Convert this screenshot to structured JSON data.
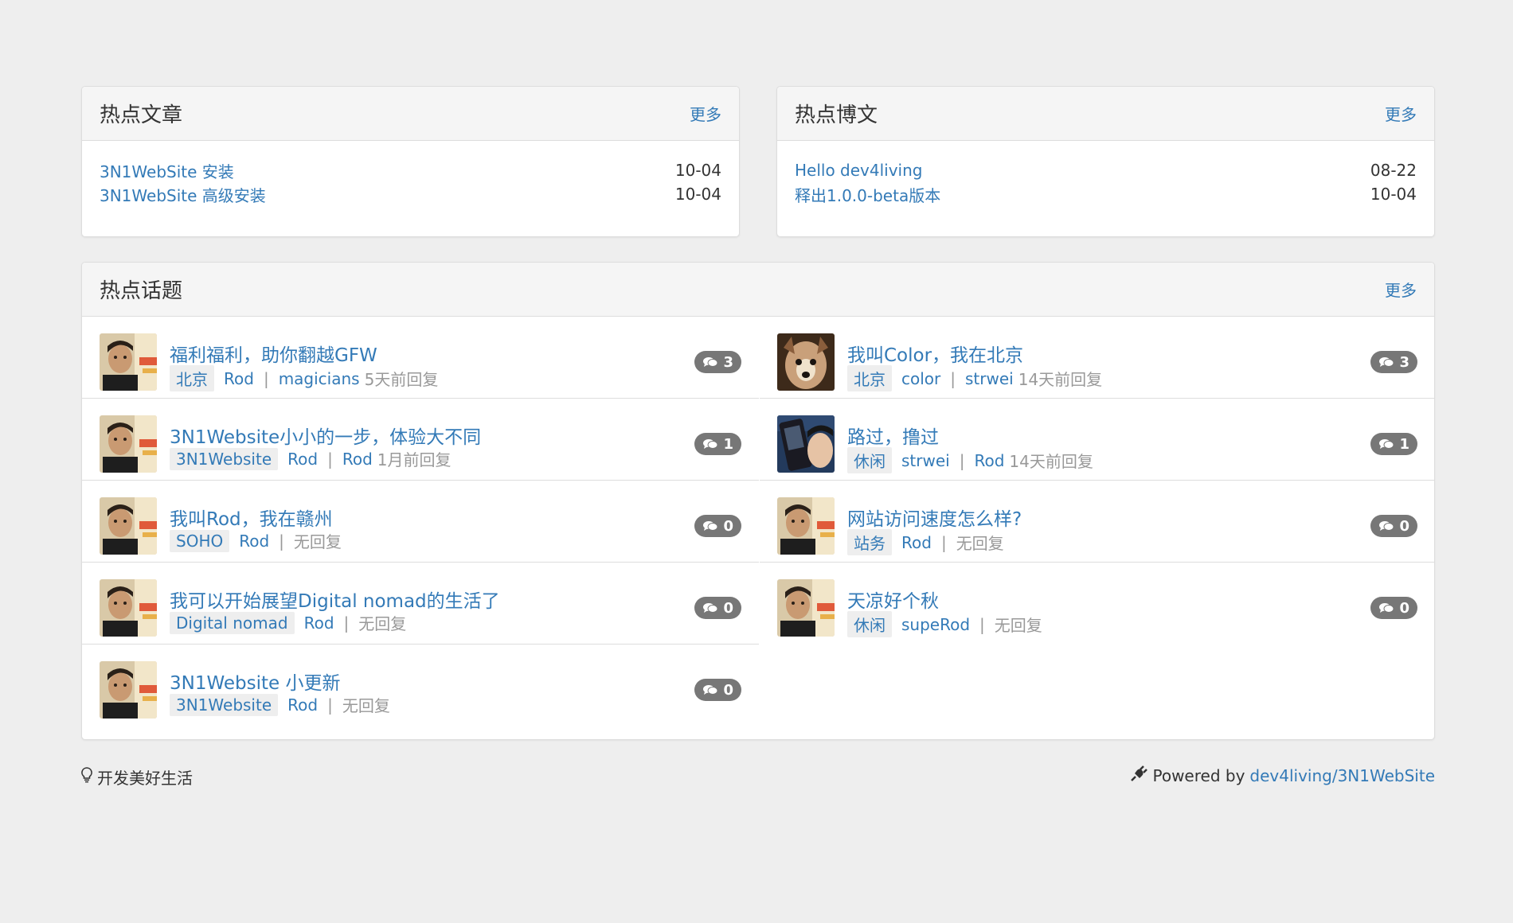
{
  "hot_articles": {
    "title": "热点文章",
    "more": "更多",
    "items": [
      {
        "title": "3N1WebSite 安装",
        "date": "10-04"
      },
      {
        "title": "3N1WebSite 高级安装",
        "date": "10-04"
      }
    ]
  },
  "hot_blogs": {
    "title": "热点博文",
    "more": "更多",
    "items": [
      {
        "title": "Hello dev4living",
        "date": "08-22"
      },
      {
        "title": "释出1.0.0-beta版本",
        "date": "10-04"
      }
    ]
  },
  "hot_topics": {
    "title": "热点话题",
    "more": "更多",
    "items": [
      {
        "title": "福利福利，助你翻越GFW",
        "tag": "北京",
        "author": "Rod",
        "replier": "magicians",
        "reply_time": "5天前回复",
        "count": "3",
        "avatar": "rod-avatar"
      },
      {
        "title": "我叫Color，我在北京",
        "tag": "北京",
        "author": "color",
        "replier": "strwei",
        "reply_time": "14天前回复",
        "count": "3",
        "avatar": "dog-avatar"
      },
      {
        "title": "3N1Website小小的一步，体验大不同",
        "tag": "3N1Website",
        "author": "Rod",
        "replier": "Rod",
        "reply_time": "1月前回复",
        "count": "1",
        "avatar": "rod-avatar"
      },
      {
        "title": "路过，撸过",
        "tag": "休闲",
        "author": "strwei",
        "replier": "Rod",
        "reply_time": "14天前回复",
        "count": "1",
        "avatar": "phone-avatar"
      },
      {
        "title": "我叫Rod，我在赣州",
        "tag": "SOHO",
        "author": "Rod",
        "replier": "",
        "reply_time": "无回复",
        "count": "0",
        "avatar": "rod-avatar"
      },
      {
        "title": "网站访问速度怎么样?",
        "tag": "站务",
        "author": "Rod",
        "replier": "",
        "reply_time": "无回复",
        "count": "0",
        "avatar": "rod-avatar"
      },
      {
        "title": "我可以开始展望Digital nomad的生活了",
        "tag": "Digital nomad",
        "author": "Rod",
        "replier": "",
        "reply_time": "无回复",
        "count": "0",
        "avatar": "rod-avatar"
      },
      {
        "title": "天凉好个秋",
        "tag": "休闲",
        "author": "supeRod",
        "replier": "",
        "reply_time": "无回复",
        "count": "0",
        "avatar": "rod-avatar"
      },
      {
        "title": "3N1Website 小更新",
        "tag": "3N1Website",
        "author": "Rod",
        "replier": "",
        "reply_time": "无回复",
        "count": "0",
        "avatar": "rod-avatar"
      }
    ]
  },
  "footer": {
    "slogan_icon": "lightbulb-icon",
    "slogan": "开发美好生活",
    "powered_icon": "plug-icon",
    "powered_prefix": "Powered by",
    "powered_link": "dev4living/3N1WebSite"
  },
  "colors": {
    "link": "#337ab7",
    "background": "#eeeeee",
    "badge": "#777777"
  }
}
